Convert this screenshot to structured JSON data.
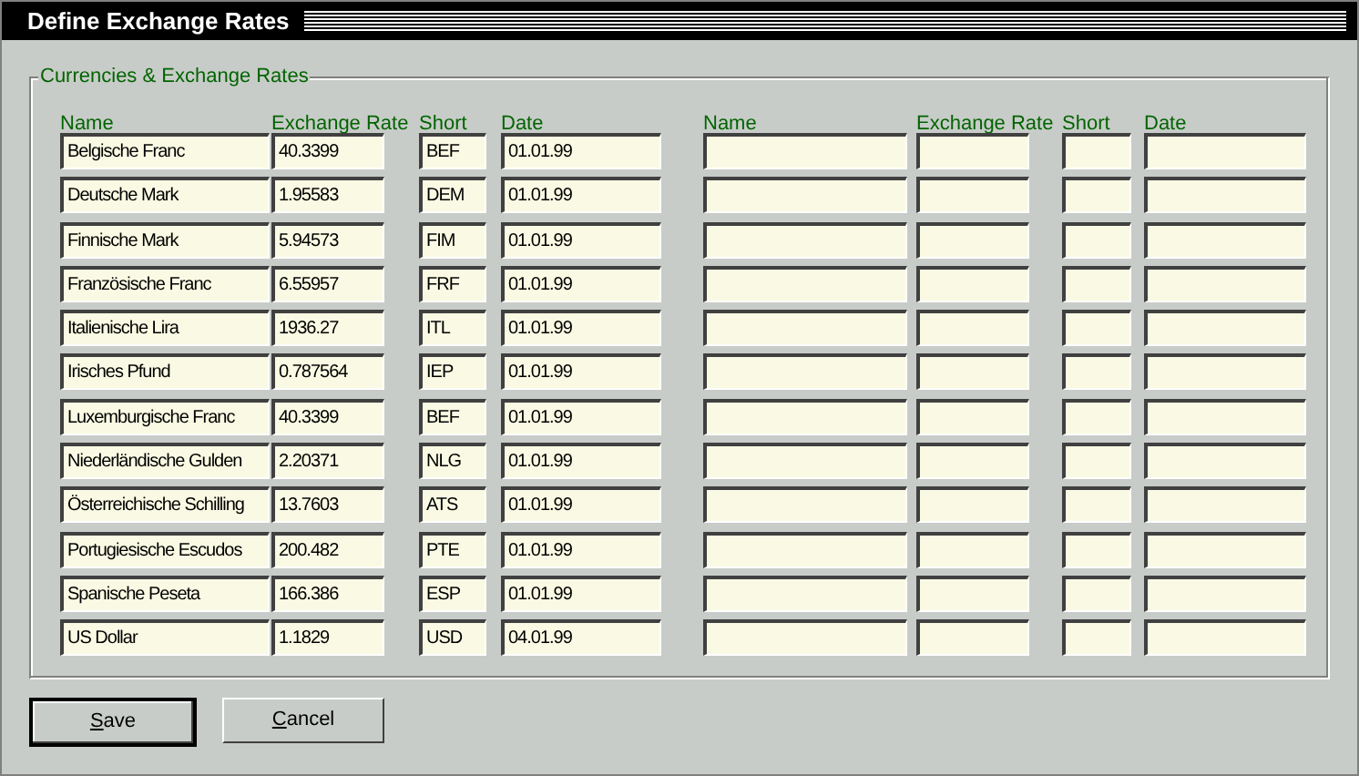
{
  "window": {
    "title": "Define Exchange Rates"
  },
  "group": {
    "title": "Currencies & Exchange Rates",
    "columns": [
      "Name",
      "Exchange Rate",
      "Short",
      "Date"
    ],
    "right_columns": [
      "Name",
      "Exchange Rate",
      "Short",
      "Date"
    ],
    "rows": [
      {
        "name": "Belgische Franc",
        "rate": "40.3399",
        "short": "BEF",
        "date": "01.01.99"
      },
      {
        "name": "Deutsche Mark",
        "rate": "1.95583",
        "short": "DEM",
        "date": "01.01.99"
      },
      {
        "name": "Finnische Mark",
        "rate": "5.94573",
        "short": "FIM",
        "date": "01.01.99"
      },
      {
        "name": "Französische Franc",
        "rate": "6.55957",
        "short": "FRF",
        "date": "01.01.99"
      },
      {
        "name": "Italienische Lira",
        "rate": "1936.27",
        "short": "ITL",
        "date": "01.01.99"
      },
      {
        "name": "Irisches Pfund",
        "rate": "0.787564",
        "short": "IEP",
        "date": "01.01.99"
      },
      {
        "name": "Luxemburgische Franc",
        "rate": "40.3399",
        "short": "BEF",
        "date": "01.01.99"
      },
      {
        "name": "Niederländische Gulden",
        "rate": "2.20371",
        "short": "NLG",
        "date": "01.01.99"
      },
      {
        "name": "Österreichische Schilling",
        "rate": "13.7603",
        "short": "ATS",
        "date": "01.01.99"
      },
      {
        "name": "Portugiesische Escudos",
        "rate": "200.482",
        "short": "PTE",
        "date": "01.01.99"
      },
      {
        "name": "Spanische Peseta",
        "rate": "166.386",
        "short": "ESP",
        "date": "01.01.99"
      },
      {
        "name": "US Dollar",
        "rate": "1.1829",
        "short": "USD",
        "date": "04.01.99"
      }
    ]
  },
  "buttons": [
    {
      "label": "Save",
      "default": true,
      "underline_first": true
    },
    {
      "label": "Cancel",
      "default": false,
      "underline_first": true
    }
  ]
}
